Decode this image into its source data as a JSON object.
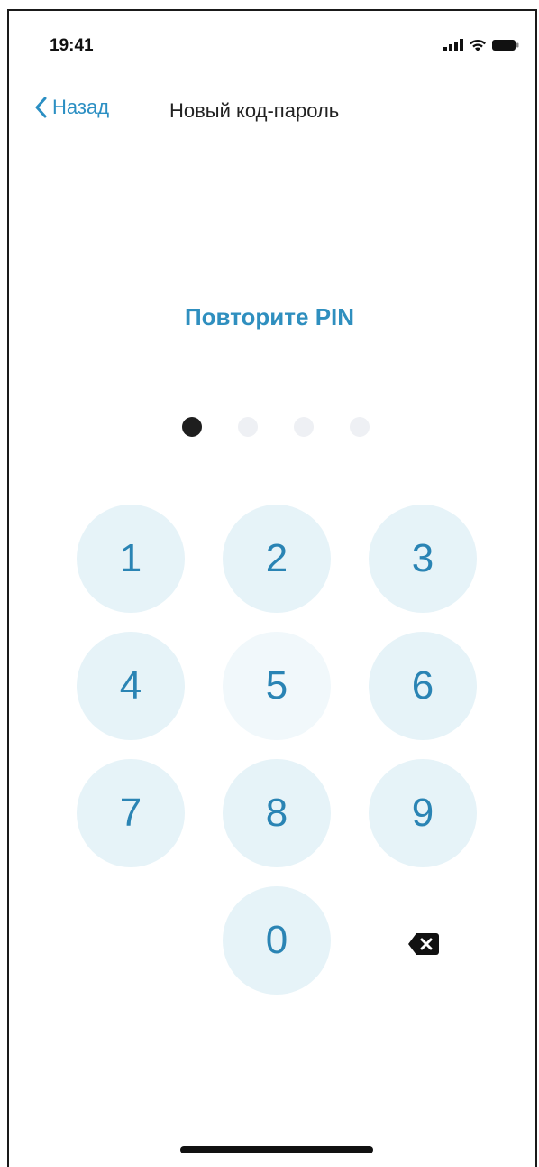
{
  "status_bar": {
    "time": "19:41"
  },
  "nav": {
    "back_label": "Назад",
    "title": "Новый код-пароль"
  },
  "pin": {
    "prompt": "Повторите PIN",
    "length": 4,
    "entered": 1
  },
  "keypad": {
    "keys": [
      "1",
      "2",
      "3",
      "4",
      "5",
      "6",
      "7",
      "8",
      "9",
      "0"
    ]
  },
  "colors": {
    "accent": "#2b8fc3",
    "key_bg": "#e6f3f8",
    "dot_filled": "#1e1e1e",
    "dot_empty": "#eef0f4"
  }
}
